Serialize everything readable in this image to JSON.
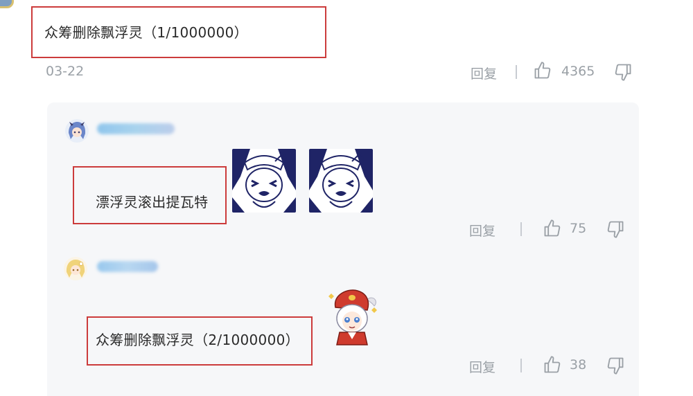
{
  "colors": {
    "highlight_box": "#cc3b3b",
    "muted_text": "#9aa0a6",
    "reply_bg": "#f6f7f9",
    "sticker_ink": "#1f2466"
  },
  "main_comment": {
    "text": "众筹删除飘浮灵（1/1000000）",
    "date": "03-22",
    "reply_label": "回复",
    "likes": "4365",
    "like_icon": "thumbs-up-icon",
    "dislike_icon": "thumbs-down-icon"
  },
  "replies": [
    {
      "avatar_icon": "blue-haired-character-avatar",
      "text": "漂浮灵滚出提瓦特",
      "sticker_icon": "crying-character-sticker",
      "reply_label": "回复",
      "likes": "75"
    },
    {
      "avatar_icon": "blonde-character-avatar",
      "text": "众筹删除飘浮灵（2/1000000）",
      "sticker_icon": "red-hat-character-sticker",
      "reply_label": "回复",
      "likes": "38"
    }
  ]
}
